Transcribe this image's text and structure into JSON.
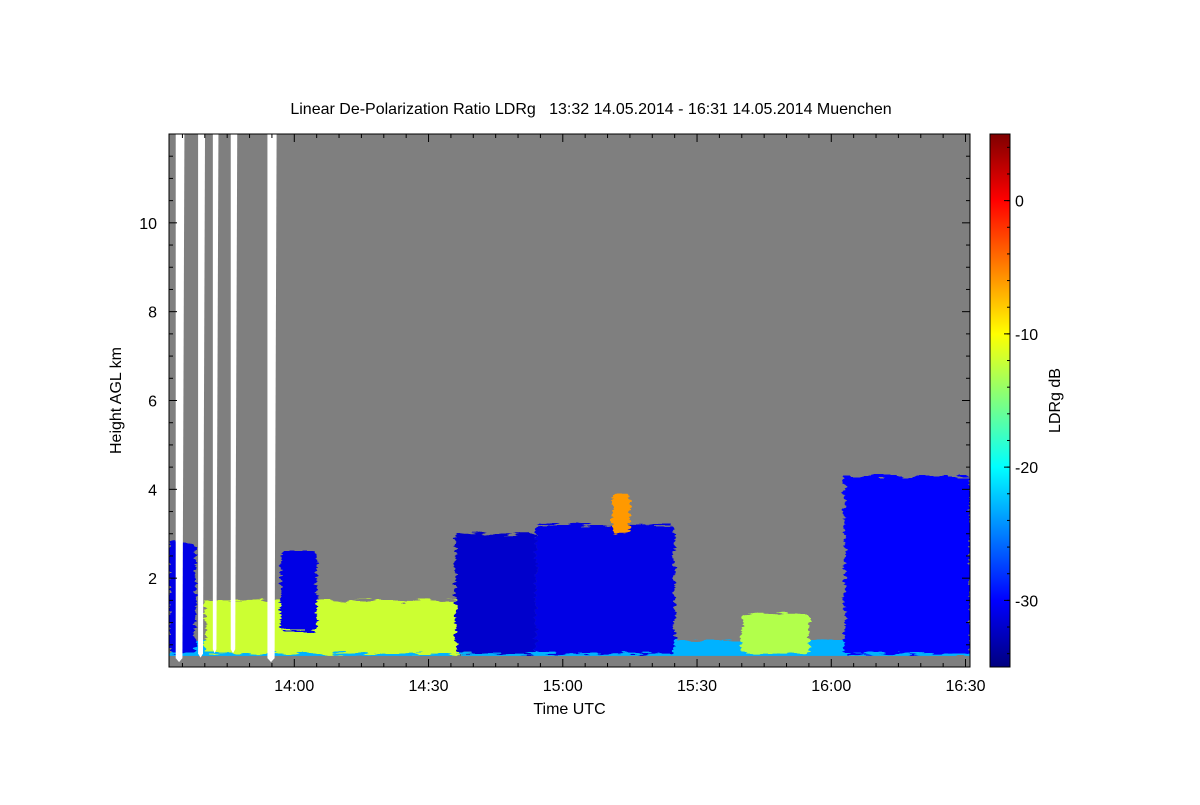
{
  "chart_data": {
    "type": "heatmap",
    "title": "Linear De-Polarization Ratio LDRg   13:32 14.05.2014 - 16:31 14.05.2014 Muenchen",
    "xlabel": "Time UTC",
    "ylabel": "Height AGL km",
    "x_range": [
      "13:32",
      "16:31"
    ],
    "xlim_minutes_utc": [
      812,
      991
    ],
    "ylim": [
      0,
      12
    ],
    "x_ticks": [
      {
        "label": "14:00",
        "value": 840
      },
      {
        "label": "14:30",
        "value": 870
      },
      {
        "label": "15:00",
        "value": 900
      },
      {
        "label": "15:30",
        "value": 930
      },
      {
        "label": "16:00",
        "value": 960
      },
      {
        "label": "16:30",
        "value": 990
      }
    ],
    "y_ticks": [
      2,
      4,
      6,
      8,
      10
    ],
    "colorbar": {
      "label": "LDRg dB",
      "min": -35,
      "max": 5,
      "ticks": [
        0,
        -10,
        -20,
        -30
      ],
      "colormap": "jet",
      "stops": [
        "#00007f",
        "#0000ff",
        "#007fff",
        "#00ffff",
        "#7fff7f",
        "#ffff00",
        "#ff7f00",
        "#ff0000",
        "#7f0000"
      ]
    },
    "no_signal_color": "#7f7f7f",
    "gap_color": "#ffffff",
    "grid": false,
    "data_gaps": [
      {
        "t0": 813.5,
        "t1": 815.0,
        "h0": 0.2,
        "h1": 12
      },
      {
        "t0": 818.5,
        "t1": 819.6,
        "h0": 0.3,
        "h1": 12
      },
      {
        "t0": 821.8,
        "t1": 822.6,
        "h0": 0.4,
        "h1": 12
      },
      {
        "t0": 825.8,
        "t1": 826.8,
        "h0": 0.4,
        "h1": 12
      },
      {
        "t0": 834.0,
        "t1": 835.6,
        "h0": 0.2,
        "h1": 12
      }
    ],
    "features": [
      {
        "name": "boundary layer aerosol",
        "t0": 812,
        "t1": 991,
        "h0": 0.2,
        "h1": 0.6,
        "ldr_db": -23
      },
      {
        "name": "aerosol layer",
        "t0": 820,
        "t1": 880,
        "h0": 0.3,
        "h1": 1.5,
        "ldr_db": -12
      },
      {
        "name": "aerosol layer",
        "t0": 940,
        "t1": 955,
        "h0": 0.3,
        "h1": 1.2,
        "ldr_db": -13
      },
      {
        "name": "cloud",
        "t0": 812,
        "t1": 818,
        "h0": 0.3,
        "h1": 2.8,
        "ldr_db": -31
      },
      {
        "name": "cloud",
        "t0": 837,
        "t1": 845,
        "h0": 0.8,
        "h1": 2.6,
        "ldr_db": -31
      },
      {
        "name": "cloud",
        "t0": 876,
        "t1": 894,
        "h0": 0.3,
        "h1": 3.0,
        "ldr_db": -32
      },
      {
        "name": "cloud",
        "t0": 894,
        "t1": 925,
        "h0": 0.3,
        "h1": 3.2,
        "ldr_db": -31
      },
      {
        "name": "ice plume",
        "t0": 911,
        "t1": 915,
        "h0": 3.0,
        "h1": 3.9,
        "ldr_db": -6
      },
      {
        "name": "cloud",
        "t0": 963,
        "t1": 991,
        "h0": 0.3,
        "h1": 4.3,
        "ldr_db": -30
      }
    ]
  }
}
